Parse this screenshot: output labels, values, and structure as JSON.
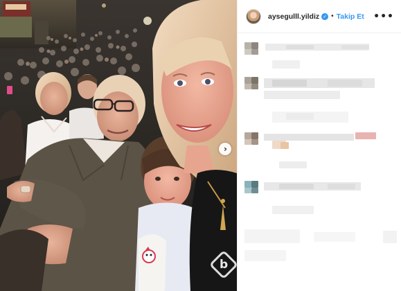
{
  "post": {
    "username": "aysegulll.yildiz",
    "separator": "•",
    "follow_label": "Takip Et",
    "more_label": "•••",
    "next_label": "›",
    "verified_label": "✓"
  },
  "watermark": {
    "letter": "b"
  },
  "icons": {
    "avatar": "profile-avatar",
    "verified": "verified-badge-icon",
    "more": "more-options-icon",
    "next": "chevron-right-icon",
    "watermark": "site-logo-watermark"
  },
  "colors": {
    "accent": "#3897f0",
    "text": "#262626",
    "border": "#efefef"
  }
}
